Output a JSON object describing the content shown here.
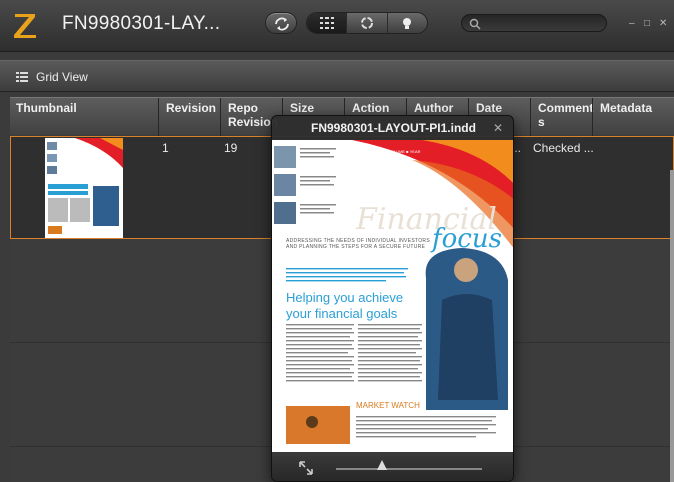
{
  "titlebar": {
    "logo_letter": "Z",
    "title": "FN9980301-LAY...",
    "buttons": {
      "refresh": "refresh-icon",
      "grid_view": "grid-icon",
      "recycle": "recycle-icon",
      "light": "lightbulb-icon"
    },
    "search_placeholder": "",
    "window_controls": [
      "–",
      "□",
      "✕"
    ]
  },
  "toolbar": {
    "label": "Grid View",
    "icon": "grid-icon"
  },
  "table": {
    "columns": [
      "Thumbnail",
      "Revision",
      "Repo Revision",
      "Size",
      "Action",
      "Author",
      "Date",
      "Comment",
      "Metadata"
    ],
    "columns_wrapped": {
      "repo_line1": "Repo",
      "repo_line2": "Revision",
      "comment_line1": "Comment",
      "comment_line2": "s"
    },
    "rows": [
      {
        "revision": "1",
        "repo_revision": "19",
        "date_partial": "...",
        "comment": "Checked ..."
      }
    ]
  },
  "preview": {
    "title": "FN9980301-LAYOUT-PI1.indd",
    "close": "✕",
    "page": {
      "heading_big": "Financial",
      "heading_script": "focus",
      "tagline": "ADDRESSING THE NEEDS OF INDIVIDUAL INVESTORS AND PLANNING THE STEPS FOR A SECURE FUTURE",
      "headline_1": "Helping you achieve",
      "headline_2": "your financial goals",
      "market_watch": "MARKET WATCH",
      "issue_info": "■ ISSUE  ■ VOLUME  ■ YEAR"
    },
    "zoom_level": 0.33
  },
  "colors": {
    "accent_orange": "#d9822b",
    "headline_blue": "#2a9fd6",
    "logo_yellow": "#e8a31b"
  }
}
